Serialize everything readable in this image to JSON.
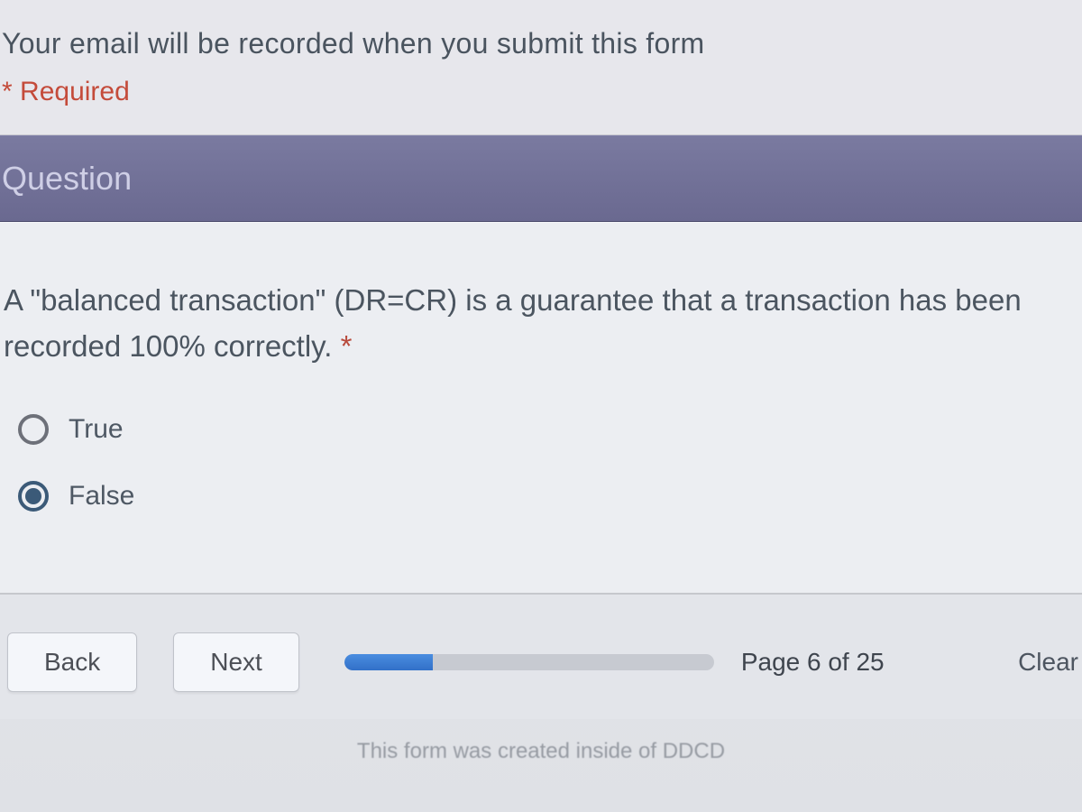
{
  "header": {
    "email_note": "Your email will be recorded when you submit this form",
    "required_marker": "*",
    "required_label": "Required"
  },
  "section": {
    "title": "Question"
  },
  "question": {
    "text": "A \"balanced transaction\" (DR=CR) is a guarantee that a transaction has been recorded 100% correctly.",
    "required_marker": "*",
    "options": [
      {
        "label": "True",
        "selected": false
      },
      {
        "label": "False",
        "selected": true
      }
    ]
  },
  "nav": {
    "back_label": "Back",
    "next_label": "Next",
    "page_indicator": "Page 6 of 25",
    "clear_label": "Clear",
    "progress_percent": 24
  },
  "footer": {
    "note": "This form was created inside of DDCD"
  }
}
